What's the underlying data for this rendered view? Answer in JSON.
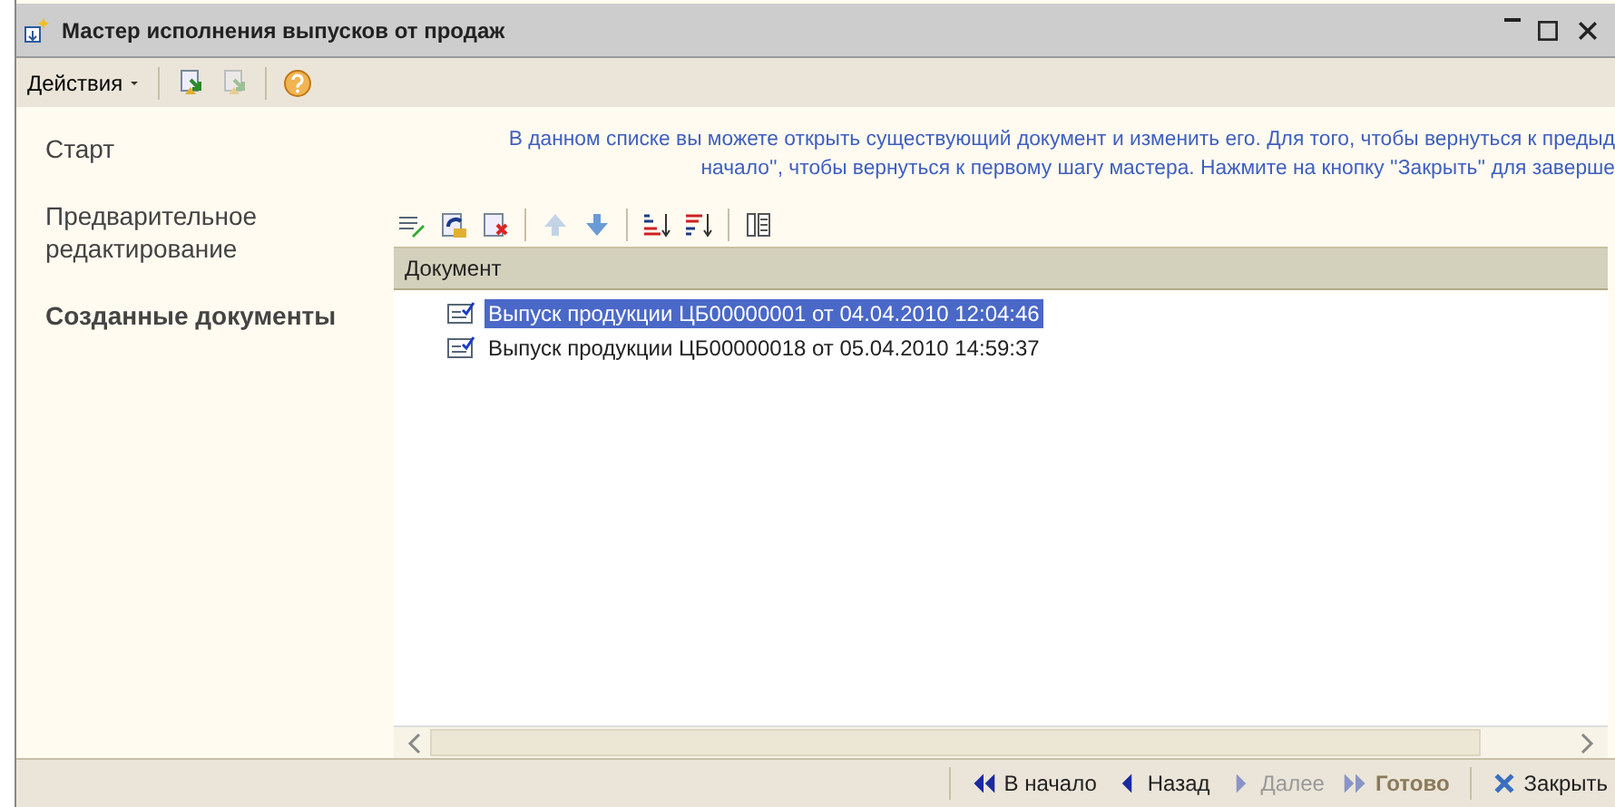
{
  "window": {
    "title": "Мастер исполнения выпусков от продаж"
  },
  "toolbar": {
    "menu": "Действия",
    "buttons": [
      {
        "kind": "check-in",
        "disabled": false
      },
      {
        "kind": "check-in",
        "disabled": true
      },
      {
        "kind": "help",
        "disabled": false
      }
    ]
  },
  "steps": [
    {
      "label": "Старт",
      "selected": false
    },
    {
      "label": "Предварительное редактирование",
      "selected": false
    },
    {
      "label": "Созданные документы",
      "selected": true
    }
  ],
  "info_lines": [
    "В данном списке вы можете открыть существующий документ и изменить его. Для того, чтобы вернуться к предыд",
    "начало'', чтобы вернуться к первому шагу мастера. Нажмите на кнопку ''Закрыть'' для заверше"
  ],
  "list_toolbar": [
    {
      "kind": "edit",
      "disabled": false
    },
    {
      "kind": "open",
      "disabled": false
    },
    {
      "kind": "delete",
      "disabled": false
    },
    {
      "kind": "up",
      "disabled": true
    },
    {
      "kind": "down",
      "disabled": false
    },
    {
      "kind": "sort-asc",
      "disabled": false
    },
    {
      "kind": "sort-desc",
      "disabled": false
    },
    {
      "kind": "columns",
      "disabled": false
    }
  ],
  "table": {
    "columns": [
      "Документ"
    ],
    "rows": [
      {
        "document": "Выпуск продукции ЦБ00000001 от 04.04.2010 12:04:46",
        "selected": true
      },
      {
        "document": "Выпуск продукции ЦБ00000018 от 05.04.2010 14:59:37",
        "selected": false
      }
    ]
  },
  "footer_buttons": [
    {
      "kind": "first",
      "label": "В начало",
      "disabled": false
    },
    {
      "kind": "back",
      "label": "Назад",
      "disabled": false
    },
    {
      "kind": "next",
      "label": "Далее",
      "disabled": true
    },
    {
      "kind": "finish",
      "label": "Готово",
      "disabled": true
    },
    {
      "kind": "close",
      "label": "Закрыть",
      "disabled": false
    }
  ]
}
